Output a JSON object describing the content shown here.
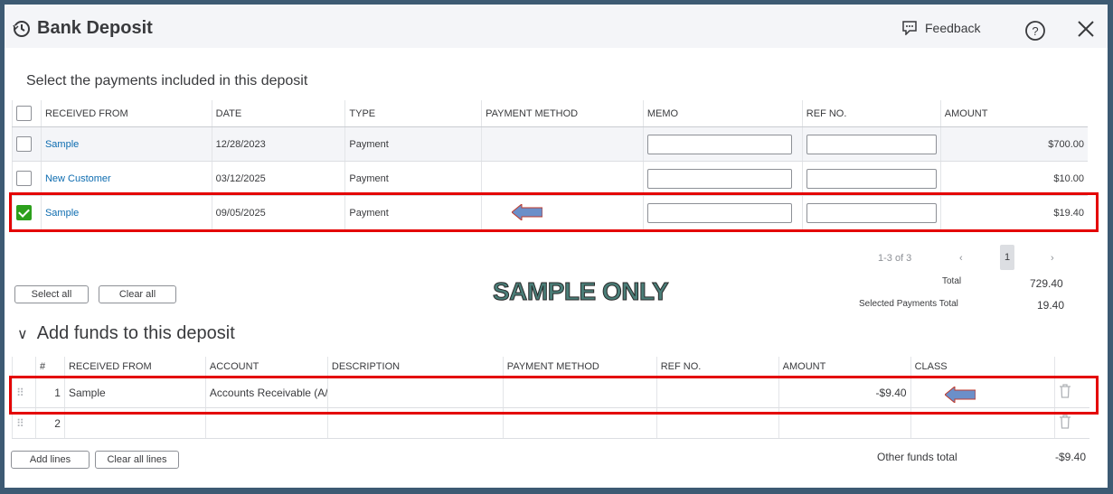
{
  "window": {
    "title": "Bank Deposit",
    "feedback_label": "Feedback",
    "help_symbol": "?",
    "close_symbol": "✕",
    "icons": {
      "title": "history-icon",
      "feedback": "chat-bubble-icon",
      "help": "help-circle-icon",
      "close": "close-icon"
    }
  },
  "payments": {
    "heading": "Select the payments included in this deposit",
    "columns": [
      "RECEIVED FROM",
      "DATE",
      "TYPE",
      "PAYMENT METHOD",
      "MEMO",
      "REF NO.",
      "AMOUNT"
    ],
    "rows": [
      {
        "checked": false,
        "received_from": "Sample",
        "date": "12/28/2023",
        "type": "Payment",
        "payment_method": "",
        "memo": "",
        "ref_no": "",
        "amount": "$700.00"
      },
      {
        "checked": false,
        "received_from": "New Customer",
        "date": "03/12/2025",
        "type": "Payment",
        "payment_method": "",
        "memo": "",
        "ref_no": "",
        "amount": "$10.00"
      },
      {
        "checked": true,
        "received_from": "Sample",
        "date": "09/05/2025",
        "type": "Payment",
        "payment_method": "",
        "memo": "",
        "ref_no": "",
        "amount": "$19.40"
      }
    ],
    "select_all_label": "Select all",
    "clear_all_label": "Clear all",
    "pager": {
      "range": "1-3 of 3",
      "prev": "‹",
      "page": "1",
      "next": "›"
    },
    "total_label": "Total",
    "total_value": "729.40",
    "selected_total_label": "Selected Payments Total",
    "selected_total_value": "19.40"
  },
  "watermark": "SAMPLE ONLY",
  "funds": {
    "heading": "Add funds to this deposit",
    "chevron": "∨",
    "columns": [
      "#",
      "RECEIVED FROM",
      "ACCOUNT",
      "DESCRIPTION",
      "PAYMENT METHOD",
      "REF NO.",
      "AMOUNT",
      "CLASS"
    ],
    "rows": [
      {
        "num": "1",
        "received_from": "Sample",
        "account": "Accounts Receivable (A/",
        "description": "",
        "payment_method": "",
        "ref_no": "",
        "amount": "-$9.40",
        "class": ""
      },
      {
        "num": "2",
        "received_from": "",
        "account": "",
        "description": "",
        "payment_method": "",
        "ref_no": "",
        "amount": "",
        "class": ""
      }
    ],
    "add_lines_label": "Add lines",
    "clear_all_lines_label": "Clear all lines",
    "other_total_label": "Other funds total",
    "other_total_value": "-$9.40"
  },
  "colors": {
    "frame": "#3d5a73",
    "highlight": "#e40000",
    "arrow": "#6b8fc9",
    "link": "#0d6cb0",
    "check": "#2ca01c"
  }
}
